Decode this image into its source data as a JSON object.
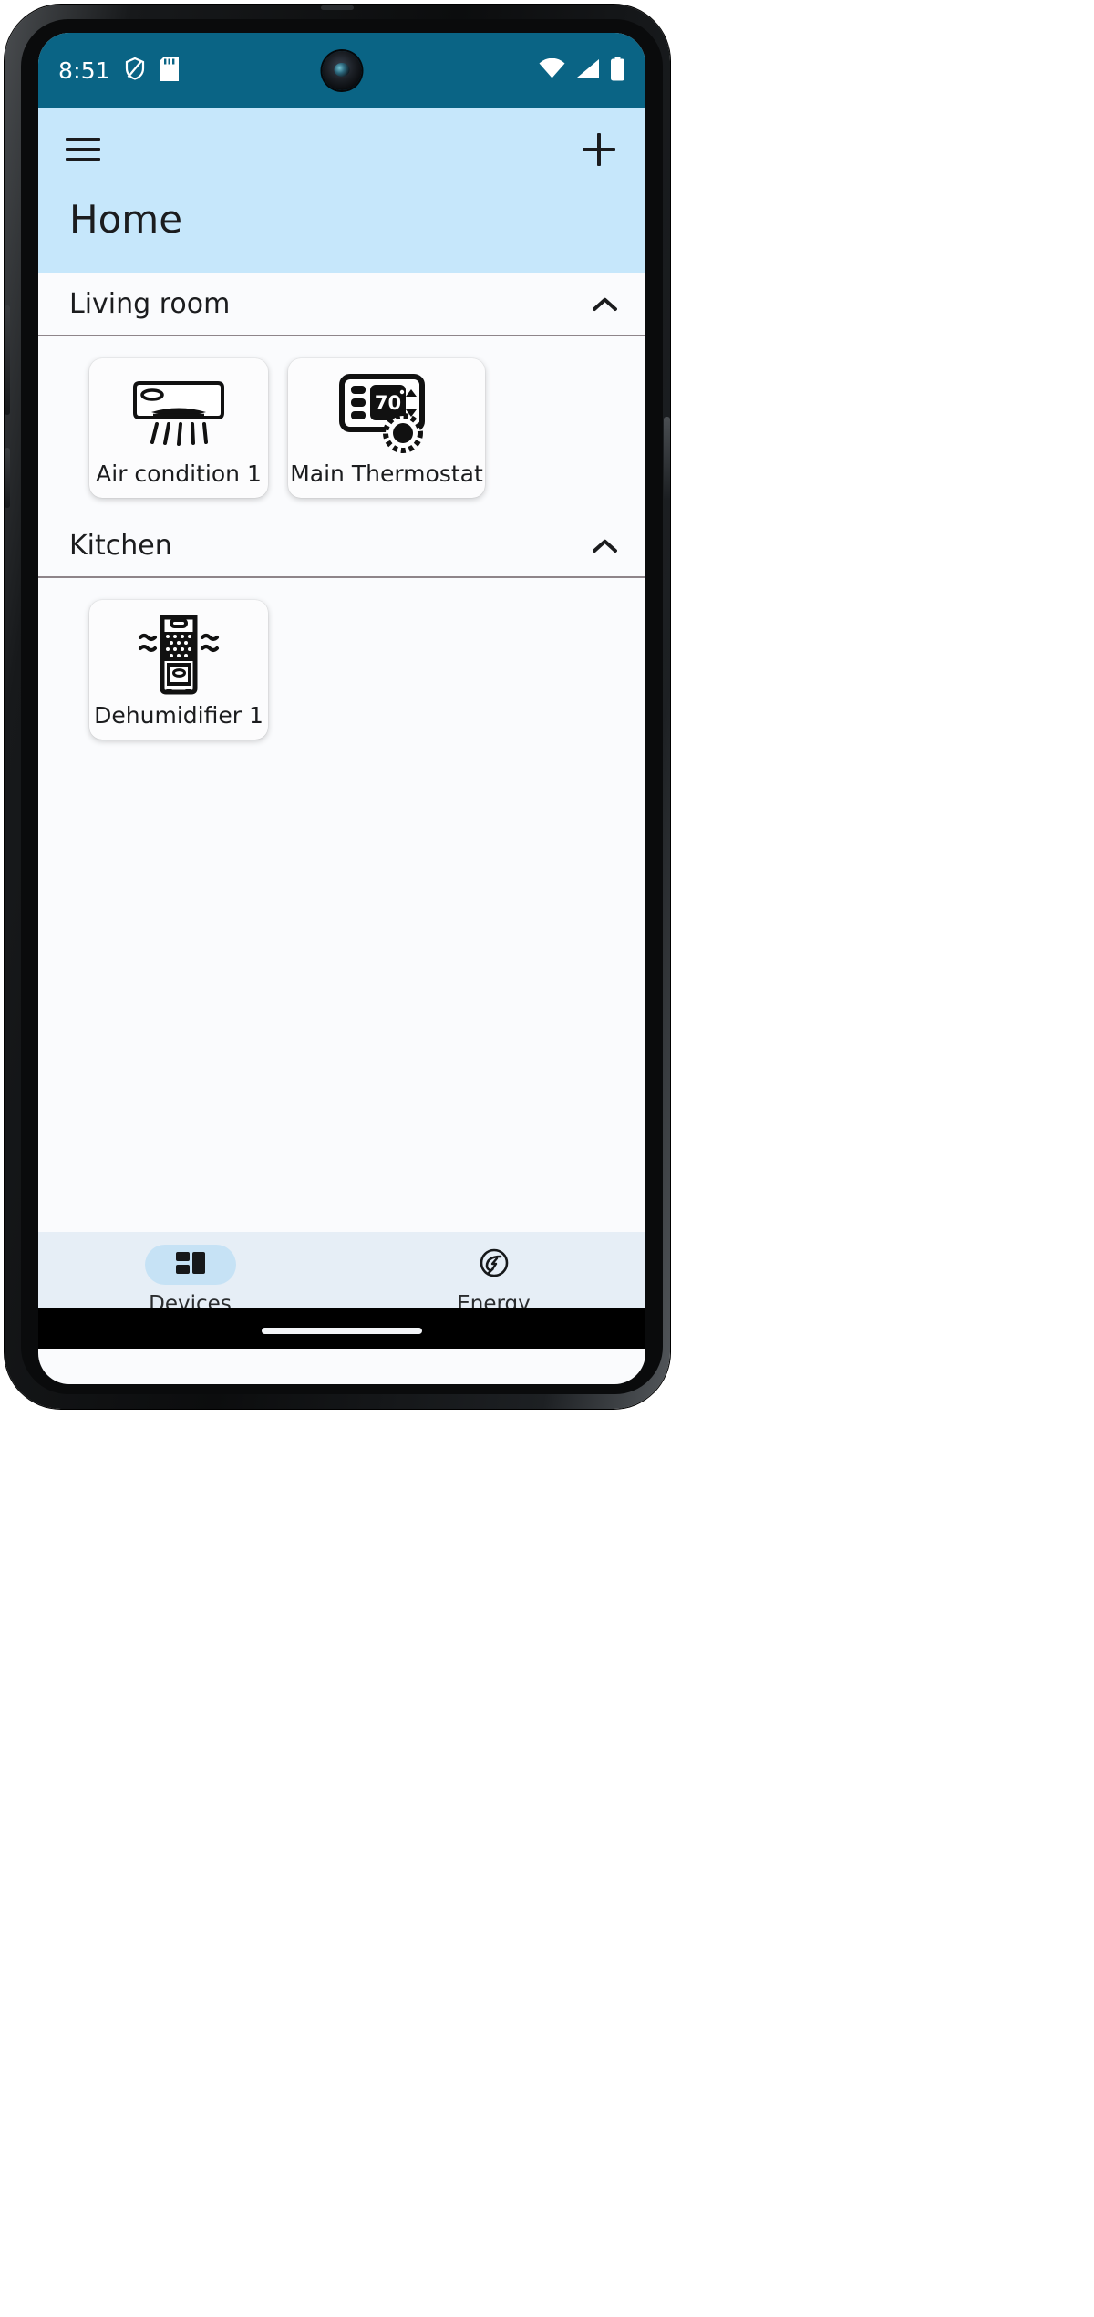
{
  "status_bar": {
    "time": "8:51",
    "left_icons": [
      "shield-vpn-icon",
      "sd-card-icon"
    ],
    "right_icons": [
      "wifi-icon",
      "cellular-signal-icon",
      "battery-icon"
    ],
    "background_color": "#0a6485"
  },
  "app_bar": {
    "menu_icon": "hamburger-menu-icon",
    "add_icon": "plus-icon",
    "title": "Home",
    "background_color": "#c6e7fb"
  },
  "rooms": [
    {
      "name": "Living room",
      "expanded": true,
      "collapse_icon": "chevron-up-icon",
      "devices": [
        {
          "label": "Air condition 1",
          "icon": "air-conditioner-icon"
        },
        {
          "label": "Main Thermostat",
          "icon": "thermostat-icon",
          "display_value": "70°"
        }
      ]
    },
    {
      "name": "Kitchen",
      "expanded": true,
      "collapse_icon": "chevron-up-icon",
      "devices": [
        {
          "label": "Dehumidifier 1",
          "icon": "dehumidifier-icon"
        }
      ]
    }
  ],
  "bottom_nav": {
    "background_color": "#e6eef6",
    "active_pill_color": "#c6e2f5",
    "items": [
      {
        "label": "Devices",
        "icon": "dashboard-grid-icon",
        "active": true
      },
      {
        "label": "Energy",
        "icon": "energy-leaf-icon",
        "active": false
      }
    ]
  }
}
